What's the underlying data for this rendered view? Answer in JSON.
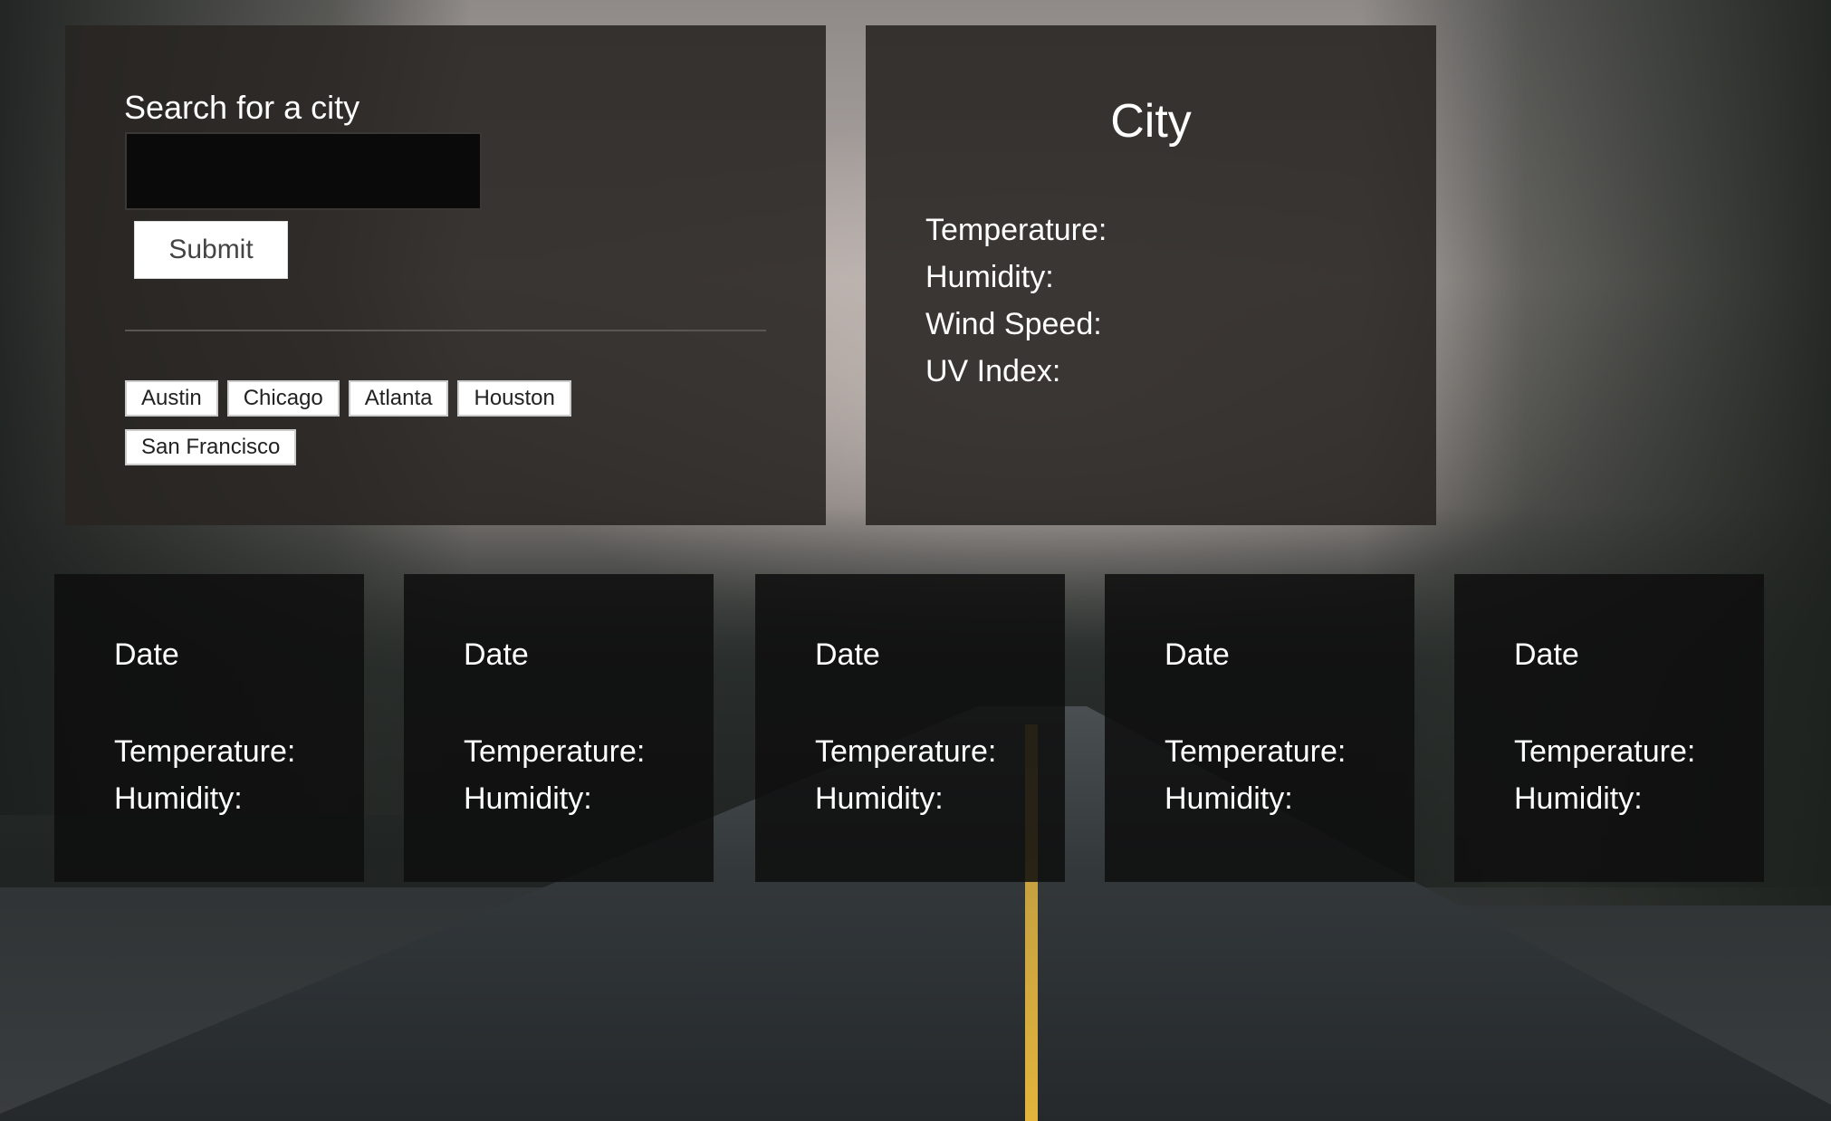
{
  "search": {
    "label": "Search for a city",
    "input_value": "",
    "input_placeholder": "",
    "submit_label": "Submit",
    "history": [
      "Austin",
      "Chicago",
      "Atlanta",
      "Houston",
      "San Francisco"
    ]
  },
  "current": {
    "city": "City",
    "temperature_label": "Temperature:",
    "humidity_label": "Humidity:",
    "wind_label": "Wind Speed:",
    "uv_label": "UV Index:"
  },
  "forecast": [
    {
      "date": "Date",
      "temperature_label": "Temperature:",
      "humidity_label": "Humidity:"
    },
    {
      "date": "Date",
      "temperature_label": "Temperature:",
      "humidity_label": "Humidity:"
    },
    {
      "date": "Date",
      "temperature_label": "Temperature:",
      "humidity_label": "Humidity:"
    },
    {
      "date": "Date",
      "temperature_label": "Temperature:",
      "humidity_label": "Humidity:"
    },
    {
      "date": "Date",
      "temperature_label": "Temperature:",
      "humidity_label": "Humidity:"
    }
  ]
}
